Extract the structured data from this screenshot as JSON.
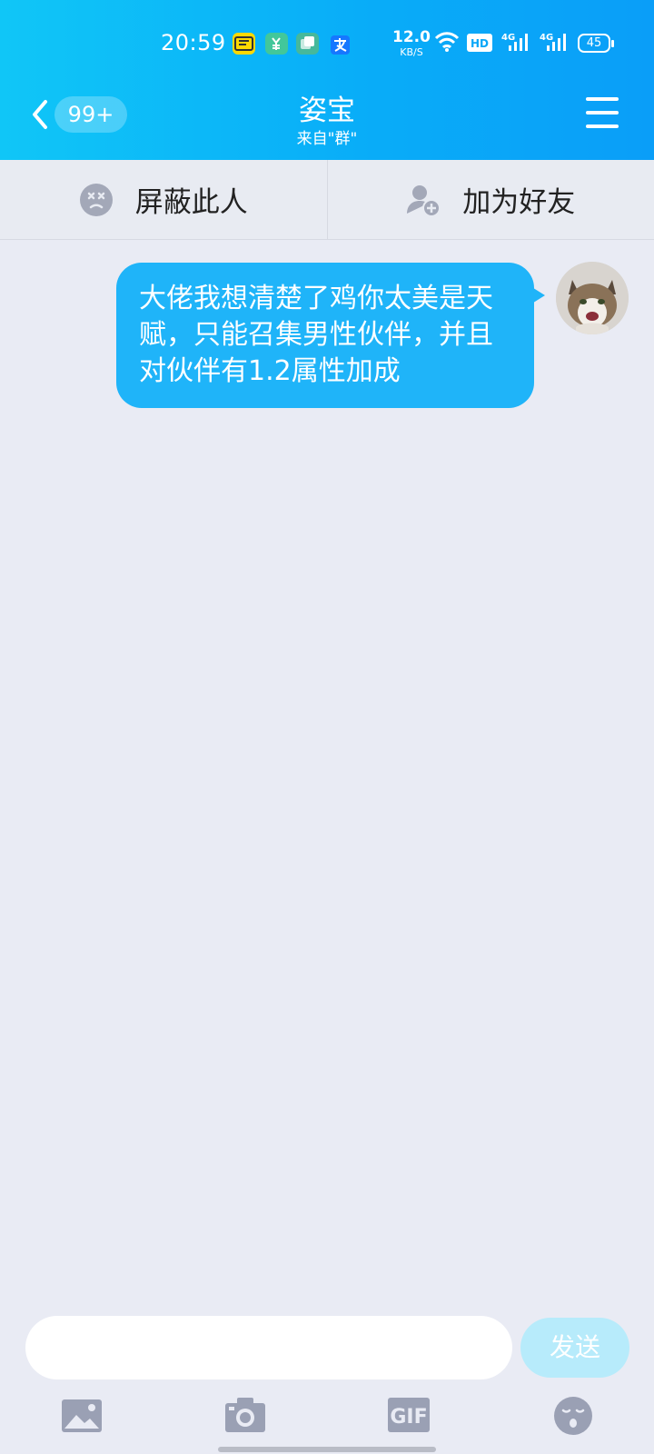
{
  "status_bar": {
    "time": "20:59",
    "net_speed_value": "12.0",
    "net_speed_unit": "KB/S",
    "hd_label": "HD",
    "signal_label_1": "4G",
    "signal_label_2": "4G",
    "battery": "45",
    "notification_icons": [
      "xianyu-app-icon",
      "app-icon-green",
      "tiles-app-icon",
      "alipay-icon"
    ]
  },
  "header": {
    "badge": "99+",
    "title": "姿宝",
    "subtitle": "来自\"群\""
  },
  "actions": {
    "block_label": "屏蔽此人",
    "add_friend_label": "加为好友"
  },
  "messages": [
    {
      "side": "right",
      "text": "大佬我想清楚了鸡你太美是天赋，只能召集男性伙伴，并且对伙伴有1.2属性加成",
      "avatar": "cat-avatar"
    }
  ],
  "composer": {
    "placeholder": "",
    "send_label": "发送"
  },
  "toolbar": {
    "gif_label": "GIF"
  },
  "colors": {
    "header_gradient_start": "#10c6f7",
    "header_gradient_end": "#0a9ef8",
    "bubble": "#1fb4f9",
    "background": "#e9ebf4",
    "send_disabled": "#b7ebfb",
    "icon_gray": "#9aa0b4"
  }
}
